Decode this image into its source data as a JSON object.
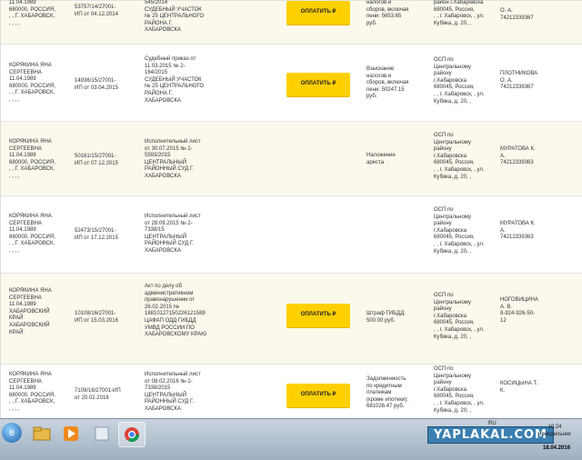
{
  "rows": [
    {
      "debtor": "11.04.1989\n680000, РОССИЯ,\n, , Г. ХАБАРОВСК,\n, , , ,",
      "case": "53757/14/27001-\nИП от 04.12.2014",
      "doc": "545/2014\nСУДЕБНЫЙ УЧАСТОК\n№ 25 ЦЕНТРАЛЬНОГО\nРАЙОНА Г.\nХАБАРОВСКА",
      "pay": "ОПЛАТИТЬ ₽",
      "subject": "налогов и\nсборов, включая\nпени: 5653.65\nруб.",
      "dept": "район г.Хабаровска\n680045, Россия,\n, , г. Хабаровск, , ул.\nКубяка, д. 20, ,",
      "officer": "О. А.\n74212339367"
    },
    {
      "debtor": "КОРЯКИНА ЯНА\nСЕРГЕЕВНА\n11.04.1989\n680000, РОССИЯ,\n, , Г. ХАБАРОВСК,\n, , , ,",
      "case": "14936/15/27001-\nИП от 03.04.2015",
      "doc": "Судебный приказ от\n11.03.2015 № 2-\n164/2015\nСУДЕБНЫЙ УЧАСТОК\n№ 25 ЦЕНТРАЛЬНОГО\nРАЙОНА Г.\nХАБАРОВСКА",
      "pay": "ОПЛАТИТЬ ₽",
      "subject": "Взыскание\nналогов и\nсборов, включая\nпени: 50247.15\nруб.",
      "dept": "ОСП по\nЦентральному\nрайону\nг.Хабаровска\n680045, Россия,\n, , г. Хабаровск, , ул.\nКубяка, д. 20, ,",
      "officer": "ПЛОТНИКОВА\nО. А.\n74212339367"
    },
    {
      "debtor": "КОРЯКИНА ЯНА\nСЕРГЕЕВНА\n11.04.1989\n680000, РОССИЯ,\n, , Г. ХАБАРОВСК,\n, , , ,",
      "case": "50161/15/27001-\nИП от 07.12.2015",
      "doc": "Исполнительный лист\nот 30.07.2015 № 2-\n5593/2015\nЦЕНТРАЛЬНЫЙ\nРАЙОННЫЙ СУД Г.\nХАБАРОВСКА",
      "pay": "",
      "subject": "Наложение\nареста",
      "dept": "ОСП по\nЦентральному\nрайону\nг.Хабаровска\n680045, Россия,\n, , г. Хабаровск, , ул.\nКубяка, д. 20, ,",
      "officer": "МУРАТОВА К.\nА.\n74212339363"
    },
    {
      "debtor": "КОРЯКИНА ЯНА\nСЕРГЕЕВНА\n11.04.1989\n680000, РОССИЯ,\n, , Г. ХАБАРОВСК,\n, , , ,",
      "case": "52473/15/27001-\nИП от 17.12.2015",
      "doc": "Исполнительный лист\nот 28.09.2015 № 2-\n7338/15\nЦЕНТРАЛЬНЫЙ\nРАЙОННЫЙ СУД Г.\nХАБАРОВСКА",
      "pay": "",
      "subject": "",
      "dept": "ОСП по\nЦентральному\nрайону\nг.Хабаровска\n680045, Россия,\n, , г. Хабаровск, , ул.\nКубяка, д. 20, ,",
      "officer": "МУРАТОВА К.\nА.\n74212339363"
    },
    {
      "debtor": "КОРЯКИНА ЯНА\nСЕРГЕЕВНА\n11.04.1989\nХАБАРОВСКИЙ\nКРАЙ\nХАБАРОВСКИЙ\nКРАЙ",
      "case": "10108/16/27001-\nИП от 15.03.2016",
      "doc": "Акт по делу об\nадминистративном\nправонарушении от\n26.02.2015 №\n18810127150226121589\nЦАФАП ОДД ГИБДД\nУМВД РОССИИ ПО\nХАБАРОВСКОМУ КРАЮ",
      "pay": "ОПЛАТИТЬ ₽",
      "subject": "Штраф ГИБДД:\n500.00 руб.",
      "dept": "ОСП по\nЦентральному\nрайону\nг.Хабаровска\n680045, Россия,\n, , г. Хабаровск, , ул.\nКубяка, д. 20, ,",
      "officer": "НОГОВИЦИНА\nА. В.\n8-924-926-50-\n12"
    },
    {
      "debtor": "КОРЯКИНА ЯНА\nСЕРГЕЕВНА\n11.04.1989\n680000, РОССИЯ,\n, , Г. ХАБАРОВСК,\n, , , ,",
      "case": "7109/16/27001-ИП\nот 20.02.2016",
      "doc": "Исполнительный лист\nот 08.02.2016 № 2-\n7338/2015\nЦЕНТРАЛЬНЫЙ\nРАЙОННЫЙ СУД Г.\nХАБАРОВСКА",
      "pay": "ОПЛАТИТЬ ₽",
      "subject": "Задолженность\nпо кредитным\nплатежам\n(кроме ипотеки):\n681026.47 руб.",
      "dept": "ОСП по\nЦентральному\nрайону\nг.Хабаровска\n680045, Россия,\n, , г. Хабаровск, , ул.\nКубяка, д. 20, ,",
      "officer": "КОСИЦЫНА Т.\nК."
    }
  ],
  "taskbar": {
    "watermark": "YAPLAKAL.COM",
    "lang": "RU",
    "time": "10:24",
    "weekday": "понедельник",
    "date": "18.04.2016"
  },
  "colors": {
    "pay_button": "#ffd000",
    "odd_row": "#fbf9ec"
  },
  "icons": [
    "ie-icon",
    "folder-icon",
    "media-player-icon",
    "chrome-icon"
  ]
}
